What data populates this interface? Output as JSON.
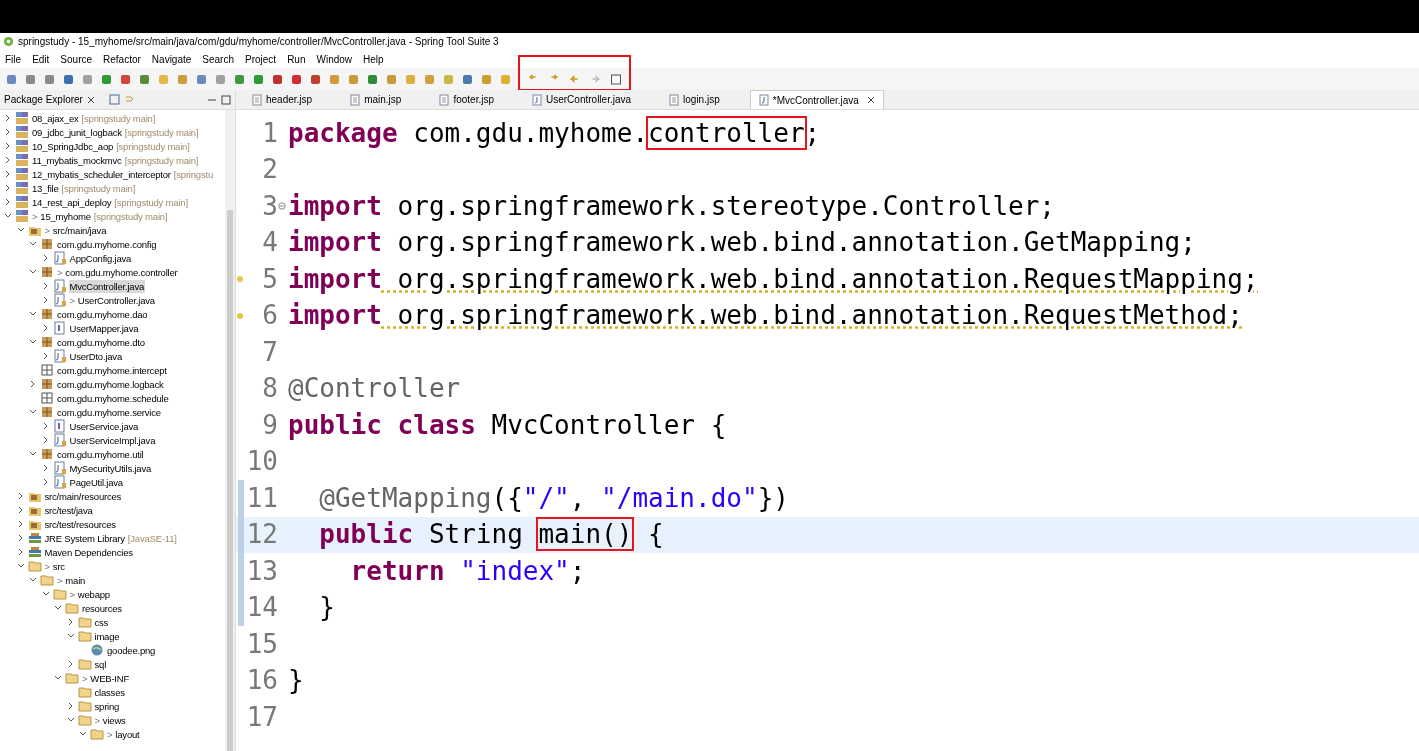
{
  "window": {
    "title": "springstudy - 15_myhome/src/main/java/com/gdu/myhome/controller/MvcController.java - Spring Tool Suite 3"
  },
  "menu": [
    "File",
    "Edit",
    "Source",
    "Refactor",
    "Navigate",
    "Search",
    "Project",
    "Run",
    "Window",
    "Help"
  ],
  "toolbar": {
    "history_group_boxed": true
  },
  "explorer": {
    "title": "Package Explorer",
    "tree": [
      {
        "label": "08_ajax_ex",
        "suffix": "[springstudy main]",
        "kind": "project",
        "expanded": false,
        "selected": false
      },
      {
        "label": "09_jdbc_junit_logback",
        "suffix": "[springstudy main]",
        "kind": "project",
        "expanded": false,
        "selected": false
      },
      {
        "label": "10_SpringJdbc_aop",
        "suffix": "[springstudy main]",
        "kind": "project",
        "expanded": false,
        "selected": false
      },
      {
        "label": "11_mybatis_mockmvc",
        "suffix": "[springstudy main]",
        "kind": "project",
        "expanded": false,
        "selected": false
      },
      {
        "label": "12_mybatis_scheduler_interceptor",
        "suffix": "[springstu",
        "kind": "project",
        "expanded": false,
        "selected": false
      },
      {
        "label": "13_file",
        "suffix": "[springstudy main]",
        "kind": "project",
        "expanded": false,
        "selected": false
      },
      {
        "label": "14_rest_api_deploy",
        "suffix": "[springstudy main]",
        "kind": "project",
        "expanded": false,
        "selected": false
      },
      {
        "label": "15_myhome",
        "suffix": "[springstudy main]",
        "marker": ">",
        "kind": "project",
        "expanded": true,
        "selected": false,
        "children": [
          {
            "label": "src/main/java",
            "marker": ">",
            "kind": "srcfolder",
            "expanded": true,
            "selected": false,
            "children": [
              {
                "label": "com.gdu.myhome.config",
                "kind": "package",
                "expanded": true,
                "selected": false,
                "children": [
                  {
                    "label": "AppConfig.java",
                    "kind": "java",
                    "expanded": false,
                    "selected": false
                  }
                ]
              },
              {
                "label": "com.gdu.myhome.controller",
                "marker": ">",
                "kind": "package",
                "expanded": true,
                "selected": false,
                "children": [
                  {
                    "label": "MvcController.java",
                    "kind": "java",
                    "expanded": false,
                    "selected": true
                  },
                  {
                    "label": "UserController.java",
                    "marker": ">",
                    "kind": "java",
                    "expanded": false,
                    "selected": false
                  }
                ]
              },
              {
                "label": "com.gdu.myhome.dao",
                "kind": "package",
                "expanded": true,
                "selected": false,
                "children": [
                  {
                    "label": "UserMapper.java",
                    "kind": "interface",
                    "expanded": false,
                    "selected": false
                  }
                ]
              },
              {
                "label": "com.gdu.myhome.dto",
                "kind": "package",
                "expanded": true,
                "selected": false,
                "children": [
                  {
                    "label": "UserDto.java",
                    "kind": "java",
                    "expanded": false,
                    "selected": false
                  }
                ]
              },
              {
                "label": "com.gdu.myhome.intercept",
                "kind": "emptypackage",
                "selected": false
              },
              {
                "label": "com.gdu.myhome.logback",
                "kind": "package",
                "expanded": false,
                "selected": false
              },
              {
                "label": "com.gdu.myhome.schedule",
                "kind": "emptypackage",
                "selected": false
              },
              {
                "label": "com.gdu.myhome.service",
                "kind": "package",
                "expanded": true,
                "selected": false,
                "children": [
                  {
                    "label": "UserService.java",
                    "kind": "interface",
                    "expanded": false,
                    "selected": false
                  },
                  {
                    "label": "UserServiceImpl.java",
                    "kind": "java",
                    "expanded": false,
                    "selected": false
                  }
                ]
              },
              {
                "label": "com.gdu.myhome.util",
                "kind": "package",
                "expanded": true,
                "selected": false,
                "children": [
                  {
                    "label": "MySecurityUtils.java",
                    "kind": "java",
                    "expanded": false,
                    "selected": false
                  },
                  {
                    "label": "PageUtil.java",
                    "kind": "java",
                    "expanded": false,
                    "selected": false
                  }
                ]
              }
            ]
          },
          {
            "label": "src/main/resources",
            "kind": "srcfolder",
            "expanded": false,
            "selected": false
          },
          {
            "label": "src/test/java",
            "kind": "srcfolder",
            "expanded": false,
            "selected": false
          },
          {
            "label": "src/test/resources",
            "kind": "srcfolder",
            "expanded": false,
            "selected": false
          },
          {
            "label": "JRE System Library",
            "suffix": "[JavaSE-11]",
            "kind": "library",
            "expanded": false,
            "selected": false
          },
          {
            "label": "Maven Dependencies",
            "kind": "library",
            "expanded": false,
            "selected": false
          },
          {
            "label": "src",
            "marker": ">",
            "kind": "folder",
            "expanded": true,
            "selected": false,
            "children": [
              {
                "label": "main",
                "marker": ">",
                "kind": "folder",
                "expanded": true,
                "selected": false,
                "children": [
                  {
                    "label": "webapp",
                    "marker": ">",
                    "kind": "folder",
                    "expanded": true,
                    "selected": false,
                    "children": [
                      {
                        "label": "resources",
                        "kind": "folder",
                        "expanded": true,
                        "selected": false,
                        "children": [
                          {
                            "label": "css",
                            "kind": "folder",
                            "expanded": false,
                            "selected": false
                          },
                          {
                            "label": "image",
                            "kind": "folder",
                            "expanded": true,
                            "selected": false,
                            "children": [
                              {
                                "label": "goodee.png",
                                "kind": "file",
                                "selected": false
                              }
                            ]
                          },
                          {
                            "label": "sql",
                            "kind": "folder",
                            "expanded": false,
                            "selected": false
                          }
                        ]
                      },
                      {
                        "label": "WEB-INF",
                        "marker": ">",
                        "kind": "folder",
                        "expanded": true,
                        "selected": false,
                        "children": [
                          {
                            "label": "classes",
                            "kind": "folder",
                            "selected": false
                          },
                          {
                            "label": "spring",
                            "kind": "folder",
                            "expanded": false,
                            "selected": false
                          },
                          {
                            "label": "views",
                            "marker": ">",
                            "kind": "folder",
                            "expanded": true,
                            "selected": false,
                            "children": [
                              {
                                "label": "layout",
                                "marker": ">",
                                "kind": "folder",
                                "expanded": true,
                                "selected": false
                              }
                            ]
                          }
                        ]
                      }
                    ]
                  }
                ]
              }
            ]
          }
        ]
      }
    ]
  },
  "tabs": [
    {
      "label": "header.jsp",
      "kind": "jsp",
      "selected": false
    },
    {
      "label": "main.jsp",
      "kind": "jsp",
      "selected": false
    },
    {
      "label": "footer.jsp",
      "kind": "jsp",
      "selected": false
    },
    {
      "label": "UserController.java",
      "kind": "java",
      "selected": false
    },
    {
      "label": "login.jsp",
      "kind": "jsp",
      "selected": false
    },
    {
      "label": "*MvcController.java",
      "kind": "java",
      "selected": true
    }
  ],
  "editor": {
    "lines": [
      {
        "number": "1",
        "tokens": [
          {
            "kind": "keyword",
            "text": "package"
          },
          {
            "kind": "plain",
            "text": " com.gdu.myhome."
          },
          {
            "kind": "plain",
            "text": "controller",
            "boxed": true
          },
          {
            "kind": "plain",
            "text": ";"
          }
        ]
      },
      {
        "number": "2"
      },
      {
        "number": "3",
        "fold": true,
        "tokens": [
          {
            "kind": "keyword",
            "text": "import"
          },
          {
            "kind": "plain",
            "text": " org.springframework.stereotype.Controller;"
          }
        ]
      },
      {
        "number": "4",
        "tokens": [
          {
            "kind": "keyword",
            "text": "import"
          },
          {
            "kind": "plain",
            "text": " org.springframework.web.bind.annotation.GetMapping;"
          }
        ]
      },
      {
        "number": "5",
        "warning": true,
        "tokens": [
          {
            "kind": "keyword",
            "text": "import"
          },
          {
            "kind": "plain",
            "text": " org.springframework.web.bind.annotation.RequestMapping;"
          }
        ]
      },
      {
        "number": "6",
        "warning": true,
        "tokens": [
          {
            "kind": "keyword",
            "text": "import"
          },
          {
            "kind": "plain",
            "text": " org.springframework.web.bind.annotation.RequestMethod;"
          }
        ]
      },
      {
        "number": "7"
      },
      {
        "number": "8",
        "tokens": [
          {
            "kind": "annotation",
            "text": "@Controller"
          }
        ]
      },
      {
        "number": "9",
        "tokens": [
          {
            "kind": "keyword",
            "text": "public"
          },
          {
            "kind": "keyword",
            "text": " class"
          },
          {
            "kind": "plain",
            "text": " MvcController {"
          }
        ]
      },
      {
        "number": "10"
      },
      {
        "number": "11",
        "changed": true,
        "tokens": [
          {
            "kind": "annotation",
            "text": "  @GetMapping"
          },
          {
            "kind": "plain",
            "text": "({"
          },
          {
            "kind": "string",
            "text": "\"/\""
          },
          {
            "kind": "plain",
            "text": ", "
          },
          {
            "kind": "string",
            "text": "\"/main.do\""
          },
          {
            "kind": "plain",
            "text": "})"
          }
        ]
      },
      {
        "number": "12",
        "changed": true,
        "current": true,
        "tokens": [
          {
            "kind": "keyword",
            "text": "  public"
          },
          {
            "kind": "plain",
            "text": " String "
          },
          {
            "kind": "plain",
            "text": "main()",
            "boxed": true
          },
          {
            "kind": "plain",
            "text": " {"
          }
        ]
      },
      {
        "number": "13",
        "changed": true,
        "tokens": [
          {
            "kind": "keyword",
            "text": "    return"
          },
          {
            "kind": "string",
            "text": " \"index\""
          },
          {
            "kind": "plain",
            "text": ";"
          }
        ]
      },
      {
        "number": "14",
        "changed": true,
        "tokens": [
          {
            "kind": "plain",
            "text": "  }"
          }
        ]
      },
      {
        "number": "15"
      },
      {
        "number": "16",
        "tokens": [
          {
            "kind": "plain",
            "text": "}"
          }
        ]
      },
      {
        "number": "17"
      }
    ]
  }
}
